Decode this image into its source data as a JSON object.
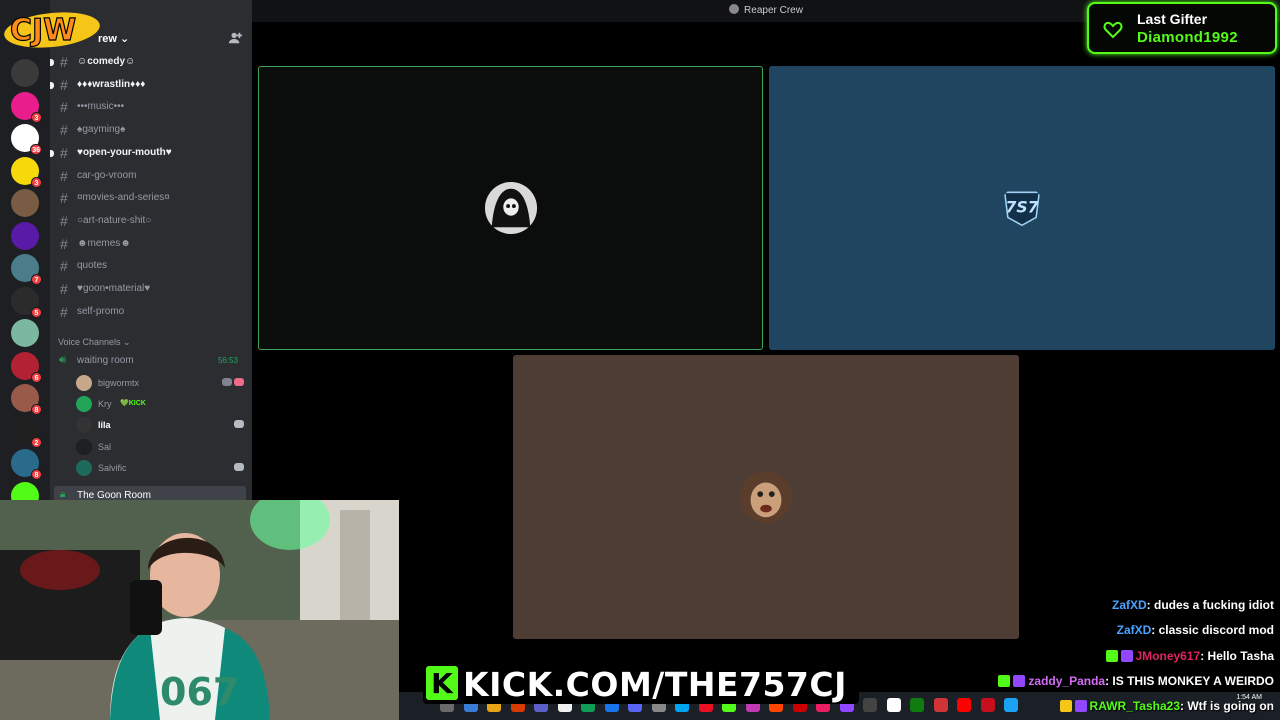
{
  "window": {
    "title": "Reaper Crew"
  },
  "server": {
    "name_visible": "rew"
  },
  "overlay_logo": {
    "text": "CJW"
  },
  "servers": [
    {
      "color": "#3a3a3a",
      "badge": ""
    },
    {
      "color": "#e91e8c",
      "badge": "3"
    },
    {
      "color": "#ffffff",
      "badge": "36"
    },
    {
      "color": "#f5d90a",
      "badge": "3"
    },
    {
      "color": "#7a5c44",
      "badge": ""
    },
    {
      "color": "#5a1aa8",
      "badge": ""
    },
    {
      "color": "#4a7c8a",
      "badge": "7"
    },
    {
      "color": "#2b2b2b",
      "badge": "5"
    },
    {
      "color": "#7ab8a0",
      "badge": ""
    },
    {
      "color": "#b22234",
      "badge": "6"
    },
    {
      "color": "#9a5a4a",
      "badge": "8"
    },
    {
      "color": "#202020",
      "badge": "2"
    },
    {
      "color": "#2a6a8a",
      "badge": "8"
    },
    {
      "color": "#53fc18",
      "badge": ""
    }
  ],
  "text_channels": [
    {
      "label": "☺comedy☺",
      "unread": true
    },
    {
      "label": "♦♦♦wrastlin♦♦♦",
      "unread": true
    },
    {
      "label": "•••music•••",
      "unread": false
    },
    {
      "label": "♠gayming♠",
      "unread": false
    },
    {
      "label": "♥open-your-mouth♥",
      "unread": true
    },
    {
      "label": "car-go-vroom",
      "unread": false
    },
    {
      "label": "¤movies-and-series¤",
      "unread": false
    },
    {
      "label": "○art-nature-shit○",
      "unread": false
    },
    {
      "label": "☻memes☻",
      "unread": false
    },
    {
      "label": "quotes",
      "unread": false
    },
    {
      "label": "♥goon•material♥",
      "unread": false
    },
    {
      "label": "self-promo",
      "unread": false
    }
  ],
  "voice": {
    "category": "Voice Channels ⌄",
    "waiting_room": {
      "label": "waiting room",
      "time": "56:53"
    },
    "users": [
      {
        "name": "bigwormtx",
        "tag": "",
        "bold": false,
        "color": "#c8a88a"
      },
      {
        "name": "Kry",
        "tag": "💚KICK",
        "bold": false,
        "color": "#23a559"
      },
      {
        "name": "lila",
        "tag": "",
        "bold": true,
        "color": "#333333"
      },
      {
        "name": "Sal",
        "tag": "",
        "bold": false,
        "color": "#1e1f22"
      },
      {
        "name": "Salvific",
        "tag": "",
        "bold": false,
        "color": "#1e6a5a"
      }
    ],
    "goon_room": "The Goon Room"
  },
  "last_gifter": {
    "label": "Last Gifter",
    "name": "Diamond1992"
  },
  "kick": {
    "k": "K",
    "url": "KICK.COM/THE757CJ"
  },
  "chat": [
    {
      "user": "ZafXD",
      "text": ": dudes a fucking idiot",
      "color": "#4aa3ff"
    },
    {
      "user": "ZafXD",
      "text": ": classic discord mod",
      "color": "#4aa3ff"
    },
    {
      "user": "JMoney617",
      "text": ": Hello Tasha",
      "color": "#e0245e"
    },
    {
      "user": "zaddy_Panda",
      "text": ": IS THIS MONKEY A WEIRDO",
      "color": "#d36cf5"
    },
    {
      "user": "RAWR_Tasha23",
      "text": ": Wtf is going on",
      "color": "#53fc18"
    }
  ],
  "clock": {
    "time": "1:54 AM"
  }
}
